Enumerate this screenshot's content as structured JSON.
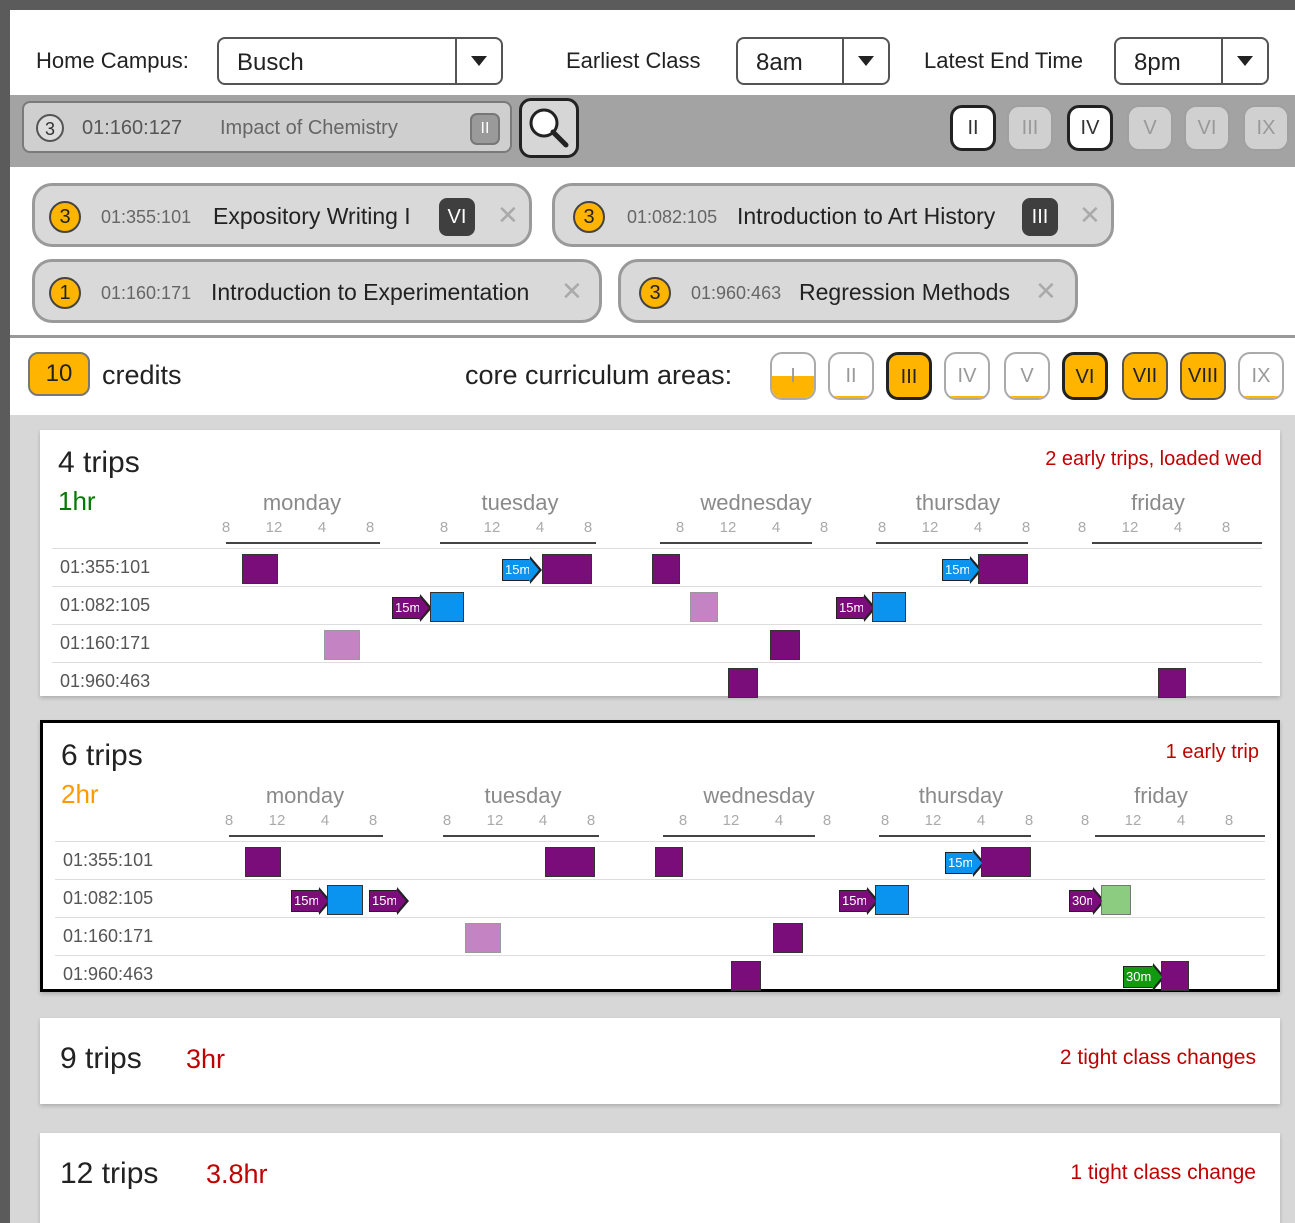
{
  "filters": {
    "home_campus_label": "Home Campus:",
    "home_campus_value": "Busch",
    "earliest_label": "Earliest Class",
    "earliest_value": "8am",
    "latest_label": "Latest End Time",
    "latest_value": "8pm"
  },
  "search": {
    "credits": "3",
    "code": "01:160:127",
    "title": "Impact of Chemistry",
    "area": "II",
    "area_filters": [
      {
        "label": "II",
        "active": true
      },
      {
        "label": "III",
        "active": false
      },
      {
        "label": "IV",
        "active": true
      },
      {
        "label": "V",
        "active": false
      },
      {
        "label": "VI",
        "active": false
      },
      {
        "label": "IX",
        "active": false
      }
    ]
  },
  "selected_courses": [
    {
      "credits": "3",
      "code": "01:355:101",
      "title": "Expository Writing I",
      "area": "VI"
    },
    {
      "credits": "3",
      "code": "01:082:105",
      "title": "Introduction to Art History",
      "area": "III"
    },
    {
      "credits": "1",
      "code": "01:160:171",
      "title": "Introduction to Experimentation",
      "area": ""
    },
    {
      "credits": "3",
      "code": "01:960:463",
      "title": "Regression Methods",
      "area": ""
    }
  ],
  "summary": {
    "credits": "10",
    "credits_label": "credits",
    "core_label": "core curriculum areas:",
    "core_areas": [
      {
        "label": "I",
        "fill": 0.5
      },
      {
        "label": "II",
        "fill": 0.05
      },
      {
        "label": "III",
        "fill": 1
      },
      {
        "label": "IV",
        "fill": 0.05
      },
      {
        "label": "V",
        "fill": 0.05
      },
      {
        "label": "VI",
        "fill": 1
      },
      {
        "label": "VII",
        "fill": 1
      },
      {
        "label": "VIII",
        "fill": 1
      },
      {
        "label": "IX",
        "fill": 0.05
      }
    ]
  },
  "days": [
    "monday",
    "tuesday",
    "wednesday",
    "thursday",
    "friday"
  ],
  "ticks": [
    "8",
    "12",
    "4",
    "8"
  ],
  "colors": {
    "short_travel": "#0a93ef",
    "class": "#7a0d7a",
    "long_travel": "#109a10",
    "good_time": "#007a00",
    "medium_time": "#ff9900",
    "bad_time": "#c00000"
  },
  "options": [
    {
      "trips": "4 trips",
      "time": "1hr",
      "note": "2 early trips, loaded wed",
      "rows": [
        "01:355:101",
        "01:082:105",
        "01:160:171",
        "01:960:463"
      ]
    },
    {
      "trips": "6 trips",
      "time": "2hr",
      "note": "1 early trip",
      "rows": [
        "01:355:101",
        "01:082:105",
        "01:160:171",
        "01:960:463"
      ]
    },
    {
      "trips": "9 trips",
      "time": "3hr",
      "note": "2 tight class changes"
    },
    {
      "trips": "12 trips",
      "time": "3.8hr",
      "note": "1 tight class change"
    }
  ],
  "travel_labels": {
    "t15": "15m",
    "t30": "30m"
  }
}
